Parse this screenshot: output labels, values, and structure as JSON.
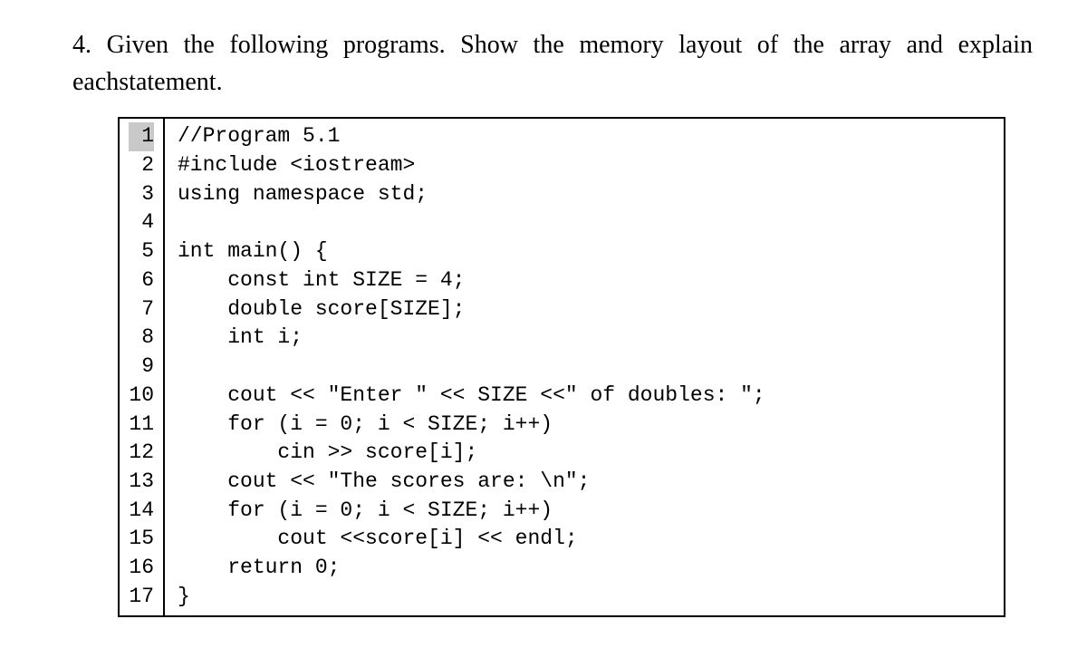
{
  "question": {
    "number": "4.",
    "text": "Given the following programs. Show the memory layout of the array and explain eachstatement."
  },
  "code": {
    "active_line": 1,
    "lines": [
      {
        "n": 1,
        "text": "//Program 5.1"
      },
      {
        "n": 2,
        "text": "#include <iostream>"
      },
      {
        "n": 3,
        "text": "using namespace std;"
      },
      {
        "n": 4,
        "text": ""
      },
      {
        "n": 5,
        "text": "int main() {"
      },
      {
        "n": 6,
        "text": "    const int SIZE = 4;"
      },
      {
        "n": 7,
        "text": "    double score[SIZE];"
      },
      {
        "n": 8,
        "text": "    int i;"
      },
      {
        "n": 9,
        "text": ""
      },
      {
        "n": 10,
        "text": "    cout << \"Enter \" << SIZE <<\" of doubles: \";"
      },
      {
        "n": 11,
        "text": "    for (i = 0; i < SIZE; i++)"
      },
      {
        "n": 12,
        "text": "        cin >> score[i];"
      },
      {
        "n": 13,
        "text": "    cout << \"The scores are: \\n\";"
      },
      {
        "n": 14,
        "text": "    for (i = 0; i < SIZE; i++)"
      },
      {
        "n": 15,
        "text": "        cout <<score[i] << endl;"
      },
      {
        "n": 16,
        "text": "    return 0;"
      },
      {
        "n": 17,
        "text": "}"
      }
    ]
  }
}
